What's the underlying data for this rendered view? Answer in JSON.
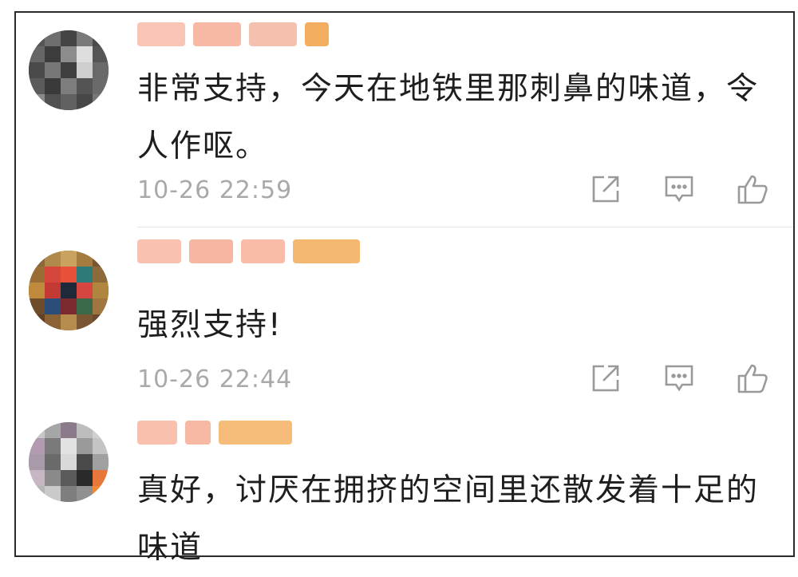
{
  "comments": [
    {
      "text": "非常支持，今天在地铁里那刺鼻的味道，令人作呕。",
      "time": "10-26 22:59",
      "actions": [
        "share-icon",
        "reply-icon",
        "like-icon"
      ]
    },
    {
      "text": "强烈支持!",
      "time": "10-26 22:44",
      "actions": [
        "share-icon",
        "reply-icon",
        "like-icon"
      ]
    },
    {
      "text": "真好，讨厌在拥挤的空间里还散发着十足的味道",
      "time": "",
      "actions": []
    }
  ],
  "colors": {
    "text": "#1e1e1e",
    "time": "#a9a9a9",
    "icon": "#9a9a9a",
    "name_blur": "#f6b8a8",
    "badge_blur": "#f3b06a"
  }
}
